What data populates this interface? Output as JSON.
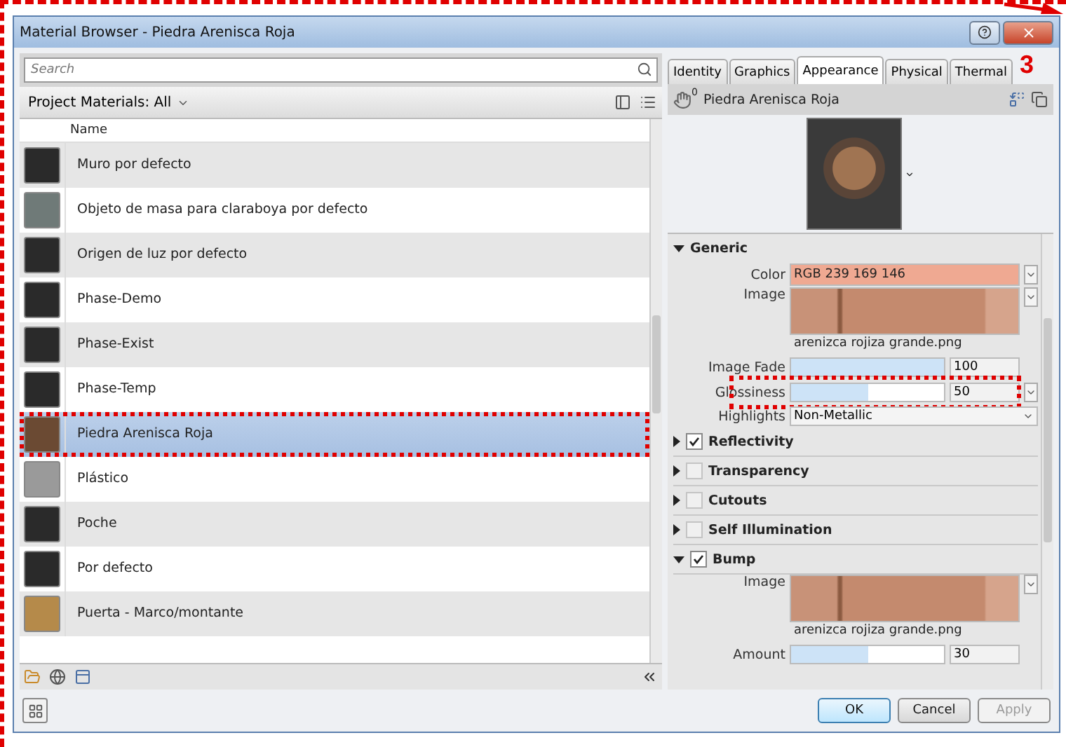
{
  "window": {
    "title": "Material Browser - Piedra Arenisca Roja"
  },
  "callout": "3",
  "search": {
    "placeholder": "Search"
  },
  "library": {
    "label": "Project Materials: All"
  },
  "list": {
    "column": "Name",
    "items": [
      {
        "name": "Muro por defecto",
        "color": "#2a2a2a",
        "selected": false,
        "annotated": false
      },
      {
        "name": "Objeto de masa para claraboya por defecto",
        "color": "#6f7a78",
        "selected": false,
        "annotated": false
      },
      {
        "name": "Origen de luz por defecto",
        "color": "#2a2a2a",
        "selected": false,
        "annotated": false
      },
      {
        "name": "Phase-Demo",
        "color": "#2a2a2a",
        "selected": false,
        "annotated": false
      },
      {
        "name": "Phase-Exist",
        "color": "#2a2a2a",
        "selected": false,
        "annotated": false
      },
      {
        "name": "Phase-Temp",
        "color": "#2a2a2a",
        "selected": false,
        "annotated": false
      },
      {
        "name": "Piedra Arenisca Roja",
        "color": "#6b4a33",
        "selected": true,
        "annotated": true
      },
      {
        "name": "Plástico",
        "color": "#9a9a9a",
        "selected": false,
        "annotated": false
      },
      {
        "name": "Poche",
        "color": "#2a2a2a",
        "selected": false,
        "annotated": false
      },
      {
        "name": "Por defecto",
        "color": "#2a2a2a",
        "selected": false,
        "annotated": false
      },
      {
        "name": "Puerta -  Marco/montante",
        "color": "#b58a4a",
        "selected": false,
        "annotated": false
      }
    ]
  },
  "tabs": [
    {
      "label": "Identity",
      "selected": false
    },
    {
      "label": "Graphics",
      "selected": false
    },
    {
      "label": "Appearance",
      "selected": true
    },
    {
      "label": "Physical",
      "selected": false
    },
    {
      "label": "Thermal",
      "selected": false
    }
  ],
  "asset": {
    "name": "Piedra Arenisca Roja",
    "users": "0"
  },
  "sections": [
    {
      "title": "Generic",
      "expanded": true,
      "properties": [
        {
          "kind": "color",
          "label": "Color",
          "value": "RGB 239 169 146",
          "color": "#efa992"
        },
        {
          "kind": "image",
          "label": "Image",
          "file": "arenizca rojiza grande.png"
        },
        {
          "kind": "slider",
          "label": "Image Fade",
          "level": 1,
          "value": "100"
        },
        {
          "kind": "slider",
          "label": "Glossiness",
          "level": 0.5,
          "value": "50",
          "annotated": true
        },
        {
          "kind": "dropdown",
          "label": "Highlights",
          "value": "Non-Metallic"
        }
      ]
    },
    {
      "title": "Reflectivity",
      "expanded": false,
      "checked": true
    },
    {
      "title": "Transparency",
      "expanded": false,
      "checked": false
    },
    {
      "title": "Cutouts",
      "expanded": false,
      "checked": false
    },
    {
      "title": "Self Illumination",
      "expanded": false,
      "checked": false
    },
    {
      "title": "Bump",
      "expanded": true,
      "checked": true,
      "properties": [
        {
          "kind": "image",
          "label": "Image",
          "file": "arenizca rojiza grande.png"
        },
        {
          "kind": "slider",
          "label": "Amount",
          "level": 0.5,
          "value": "30"
        }
      ]
    }
  ],
  "buttons": [
    {
      "label": "OK",
      "disabled": false,
      "default": true
    },
    {
      "label": "Cancel",
      "disabled": false,
      "default": false
    },
    {
      "label": "Apply",
      "disabled": true,
      "default": false
    }
  ]
}
